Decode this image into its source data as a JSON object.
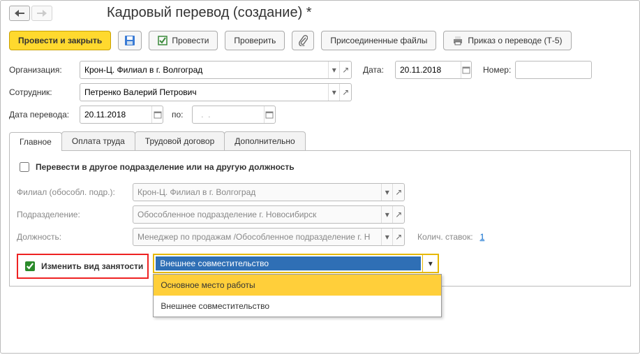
{
  "title": "Кадровый перевод (создание) *",
  "nav": {
    "back_tip": "Назад",
    "fwd_tip": "Вперёд"
  },
  "toolbar": {
    "post_close": "Провести и закрыть",
    "save_tip": "Записать",
    "post": "Провести",
    "check": "Проверить",
    "attach_tip": "Вложения",
    "files": "Присоединенные файлы",
    "print_order": "Приказ о переводе (Т-5)"
  },
  "fields": {
    "org_label": "Организация:",
    "org_value": "Крон-Ц. Филиал в г. Волгоград",
    "date_label": "Дата:",
    "date_value": "20.11.2018",
    "number_label": "Номер:",
    "number_value": "",
    "emp_label": "Сотрудник:",
    "emp_value": "Петренко Валерий Петрович",
    "transfer_date_label": "Дата перевода:",
    "transfer_date_value": "20.11.2018",
    "to_label": "по:",
    "to_value": "  .  .    "
  },
  "tabs": {
    "main": "Главное",
    "pay": "Оплата труда",
    "contract": "Трудовой договор",
    "extra": "Дополнительно"
  },
  "main_tab": {
    "transfer_other_label": "Перевести в другое подразделение или на другую должность",
    "branch_label": "Филиал (обособл. подр.):",
    "branch_value": "Крон-Ц. Филиал в г. Волгоград",
    "dept_label": "Подразделение:",
    "dept_value": "Обособленное подразделение г. Новосибирск",
    "position_label": "Должность:",
    "position_value": "Менеджер по продажам /Обособленное подразделение г. Н",
    "rates_label": "Колич. ставок:",
    "rates_value": "1",
    "emp_type_label": "Изменить вид занятости",
    "emp_type_value": "Внешнее совместительство",
    "emp_type_options": [
      "Основное место работы",
      "Внешнее совместительство"
    ]
  }
}
